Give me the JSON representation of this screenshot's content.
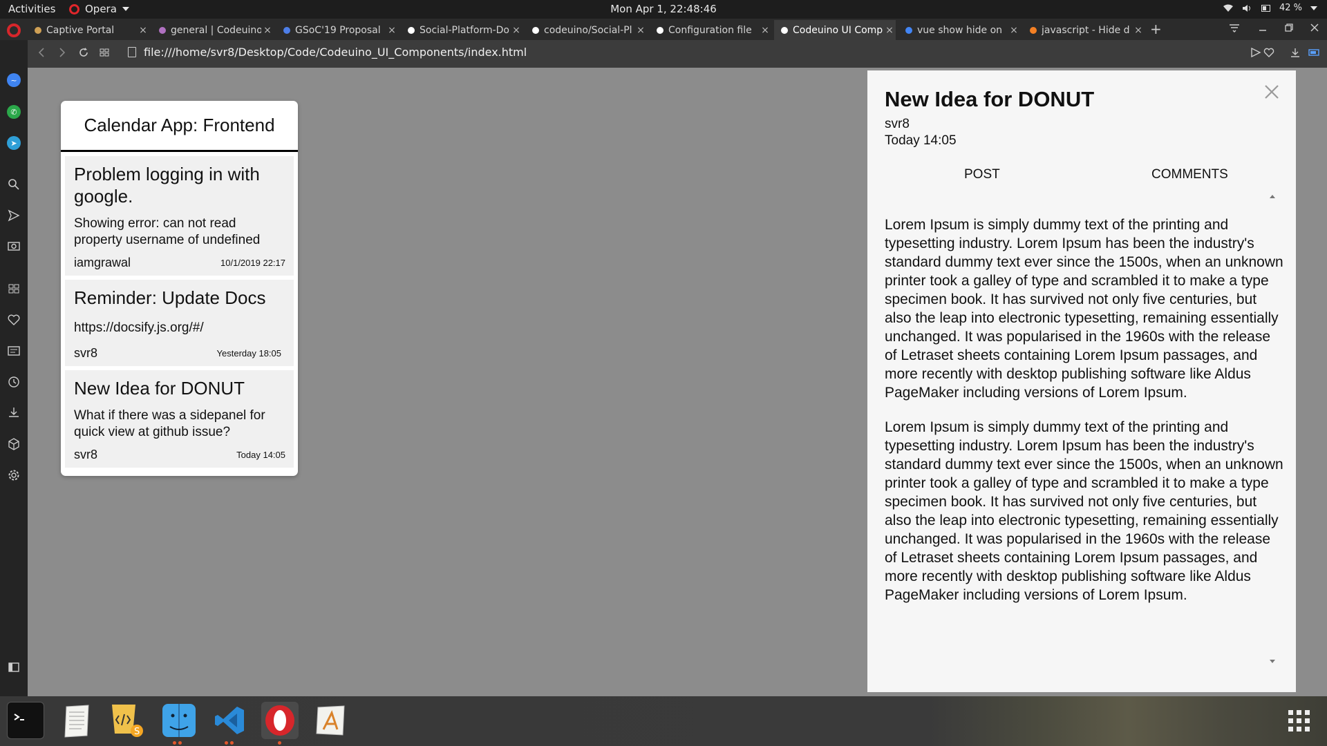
{
  "topbar": {
    "activities": "Activities",
    "app_name": "Opera",
    "clock": "Mon Apr  1, 22:48:46",
    "battery": "42 %"
  },
  "tabs": [
    {
      "label": "Captive Portal",
      "icon": "captive-portal-icon",
      "icon_color": "#cfa055"
    },
    {
      "label": "general | Codeuino",
      "icon": "slack-icon",
      "icon_color": "#b071c1"
    },
    {
      "label": "GSoC'19 Proposal",
      "icon": "docs-icon",
      "icon_color": "#4d7ee8"
    },
    {
      "label": "Social-Platform-Do",
      "icon": "github-icon",
      "icon_color": "#ffffff"
    },
    {
      "label": "codeuino/Social-Pl",
      "icon": "github-icon",
      "icon_color": "#ffffff"
    },
    {
      "label": "Configuration file",
      "icon": "github-icon",
      "icon_color": "#ffffff"
    },
    {
      "label": "Codeuino UI Comp",
      "icon": "file-icon",
      "icon_color": "#ffffff",
      "active": true
    },
    {
      "label": "vue show hide on",
      "icon": "google-icon",
      "icon_color": "#4285f4"
    },
    {
      "label": "javascript - Hide d",
      "icon": "stackoverflow-icon",
      "icon_color": "#f48024"
    }
  ],
  "address": {
    "url": "file:///home/svr8/Desktop/Code/Codeuino_UI_Components/index.html"
  },
  "board": {
    "title": "Calendar App: Frontend",
    "cards": [
      {
        "title": "Problem logging in with google.",
        "description": "Showing error: can not read property username of undefined",
        "user": "iamgrawal",
        "time": "10/1/2019 22:17"
      },
      {
        "title": "Reminder: Update Docs",
        "description": "https://docsify.js.org/#/",
        "user": "svr8",
        "time": "Yesterday 18:05"
      },
      {
        "title": "New Idea for DONUT",
        "description": "What if there was a sidepanel for quick view at github issue?",
        "user": "svr8",
        "time": "Today 14:05"
      }
    ]
  },
  "panel": {
    "title": "New Idea for DONUT",
    "user": "svr8",
    "time": "Today 14:05",
    "tabs": {
      "post": "POST",
      "comments": "COMMENTS"
    },
    "paragraphs": [
      "Lorem Ipsum is simply dummy text of the printing and typesetting industry. Lorem Ipsum has been the industry's standard dummy text ever since the 1500s, when an unknown printer took a galley of type and scrambled it to make a type specimen book. It has survived not only five centuries, but also the leap into electronic typesetting, remaining essentially unchanged. It was popularised in the 1960s with the release of Letraset sheets containing Lorem Ipsum passages, and more recently with desktop publishing software like Aldus PageMaker including versions of Lorem Ipsum.",
      "Lorem Ipsum is simply dummy text of the printing and typesetting industry. Lorem Ipsum has been the industry's standard dummy text ever since the 1500s, when an unknown printer took a galley of type and scrambled it to make a type specimen book. It has survived not only five centuries, but also the leap into electronic typesetting, remaining essentially unchanged. It was popularised in the 1960s with the release of Letraset sheets containing Lorem Ipsum passages, and more recently with desktop publishing software like Aldus PageMaker including versions of Lorem Ipsum."
    ]
  },
  "colors": {
    "opera_red": "#d7262b",
    "page_bg": "#8c8c8c",
    "card_bg": "#f0f0f0",
    "panel_bg": "#f6f6f6"
  }
}
